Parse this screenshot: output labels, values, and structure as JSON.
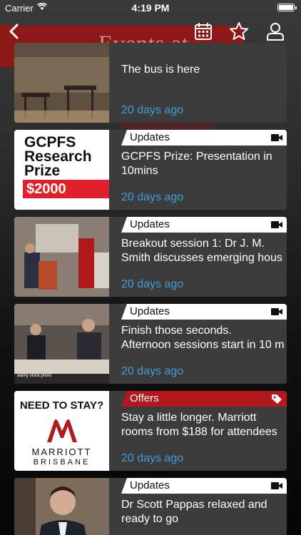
{
  "status_bar": {
    "carrier": "Carrier",
    "time": "4:19 PM"
  },
  "background": {
    "banner_text": "Events at"
  },
  "nav": {
    "back_icon": "chevron-left-icon",
    "calendar_icon": "calendar-icon",
    "favorite_icon": "star-icon",
    "profile_icon": "user-icon"
  },
  "colors": {
    "accent_blue": "#3b9fd9",
    "offers_red": "#b3191c",
    "card_bg": "#3c3c3c"
  },
  "feed": {
    "items": [
      {
        "tag": "",
        "title": "The bus is here",
        "time_ago": "20 days ago",
        "thumb": "cafe-photo"
      },
      {
        "tag": "Updates",
        "tag_icon": "video-camera-icon",
        "title": "GCPFS Prize: Presentation in\n10mins",
        "time_ago": "20 days ago",
        "thumb": "gcpfs-prize-graphic",
        "thumb_text": "GCPFS\nResearch\nPrize",
        "thumb_amount": "$2000"
      },
      {
        "tag": "Updates",
        "tag_icon": "video-camera-icon",
        "title": "Breakout session 1: Dr J. M.\nSmith discusses emerging hous",
        "time_ago": "20 days ago",
        "thumb": "presentation-photo"
      },
      {
        "tag": "Updates",
        "tag_icon": "video-camera-icon",
        "title": "Finish those seconds.\nAfternoon sessions start in 10 m",
        "time_ago": "20 days ago",
        "thumb": "buffet-photo",
        "thumb_watermark": "alamy stock photo"
      },
      {
        "tag": "Offers",
        "tag_icon": "price-tag-icon",
        "title": "Stay a little longer. Marriott\nrooms from $188 for attendees",
        "time_ago": "20 days ago",
        "thumb": "marriott-ad",
        "thumb_headline": "NEED TO STAY?",
        "thumb_brand": "MARRIOTT",
        "thumb_city": "BRISBANE"
      },
      {
        "tag": "Updates",
        "tag_icon": "video-camera-icon",
        "title": "Dr Scott Pappas relaxed and\nready to go",
        "time_ago": "",
        "thumb": "portrait-photo"
      }
    ]
  }
}
